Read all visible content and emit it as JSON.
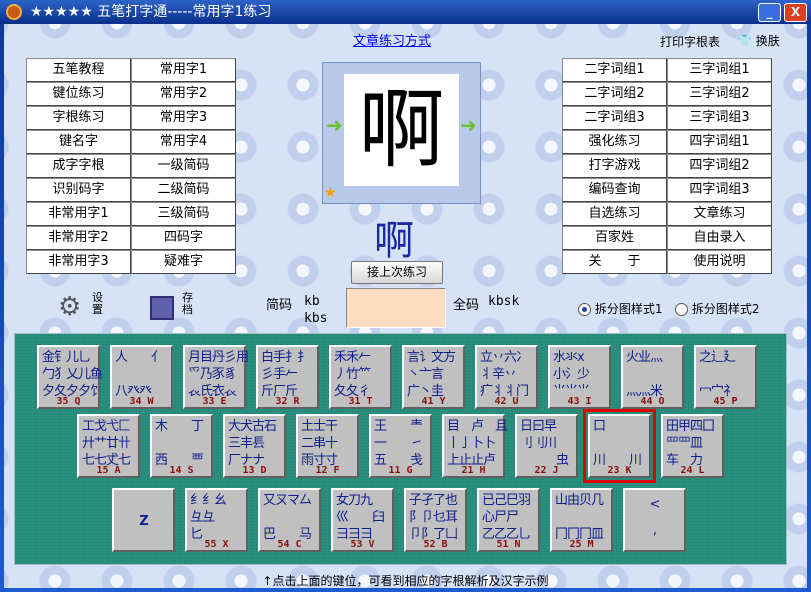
{
  "window": {
    "title": "★★★★★ 五笔打字通-----常用字1练习",
    "minimize": "_",
    "close": "X"
  },
  "top": {
    "link": "文章练习方式",
    "print": "打印字根表",
    "skin": "换肤"
  },
  "left_buttons": [
    "五笔教程",
    "常用字1",
    "键位练习",
    "常用字2",
    "字根练习",
    "常用字3",
    "键名字",
    "常用字4",
    "成字字根",
    "一级简码",
    "识别码字",
    "二级简码",
    "非常用字1",
    "三级简码",
    "非常用字2",
    "四码字",
    "非常用字3",
    "疑难字"
  ],
  "right_buttons": [
    "二字词组1",
    "三字词组1",
    "二字词组2",
    "三字词组2",
    "二字词组3",
    "三字词组3",
    "强化练习",
    "四字词组1",
    "打字游戏",
    "四字词组2",
    "编码查询",
    "四字词组3",
    "自选练习",
    "文章练习",
    "百家姓",
    "自由录入",
    "关　　于",
    "使用说明"
  ],
  "center": {
    "image_char": "啊",
    "current_char": "啊",
    "resume": "接上次练习"
  },
  "tools": {
    "settings": "设置",
    "save": "存档"
  },
  "code": {
    "short_label": "简码",
    "short_codes": [
      "kb",
      "kbs"
    ],
    "full_label": "全码",
    "full_code": "kbsk",
    "input_value": ""
  },
  "radios": [
    {
      "label": "拆分图样式1",
      "checked": true
    },
    {
      "label": "拆分图样式2",
      "checked": false
    }
  ],
  "keys_row1": [
    {
      "g": "金钅儿乚\n勹犭乂儿鱼\n夕夂夕夕饣",
      "c": "35 Q"
    },
    {
      "g": "人　　亻\n\n八癶癶",
      "c": "34 W"
    },
    {
      "g": "月目丹彡用\n爫乃豕豸\n𧘇氏衣𧘇",
      "c": "33 E"
    },
    {
      "g": "白手扌扌\n彡手𠂉\n斤厂斤",
      "c": "32 R"
    },
    {
      "g": "禾禾𠂉\n丿竹⺮\n夂夂彳",
      "c": "31 T"
    },
    {
      "g": "言讠文方\n丶亠言\n广丶圭",
      "c": "41 Y"
    },
    {
      "g": "立丷六冫\n丬辛丷\n疒丬丬门",
      "c": "42 U"
    },
    {
      "g": "水氺ⅹ\n小氵少\n⺌⺌⺌",
      "c": "43 I"
    },
    {
      "g": "火业灬\n\n灬灬米",
      "c": "44 O"
    },
    {
      "g": "之辶廴\n\n冖宀礻",
      "c": "45 P"
    }
  ],
  "keys_row2": [
    {
      "g": "工戈弋匚\n廾艹廿卄\n七七𠀋七",
      "c": "15 A"
    },
    {
      "g": "木　　丁\n\n西　　覀",
      "c": "14 S"
    },
    {
      "g": "大犬古石\n三丰镸\n厂ナナ",
      "c": "13 D"
    },
    {
      "g": "土士干\n二串十\n雨寸寸",
      "c": "12 F"
    },
    {
      "g": "王　　龶\n一　　㇀\n五　　戋",
      "c": "11 G"
    },
    {
      "g": "目　卢　且\n丨亅卜卜\n上止止卢",
      "c": "21 H"
    },
    {
      "g": "日曰早\n刂刂川\n　　　虫",
      "c": "22 J"
    },
    {
      "g": "口\n\n川　　川",
      "c": "23 K"
    },
    {
      "g": "田甲四囗\n罒罒皿\n车　力",
      "c": "24 L"
    }
  ],
  "keys_row3": [
    {
      "g": "Z",
      "c": "",
      "big": true
    },
    {
      "g": "纟纟幺\n彑彑\n匕　　",
      "c": "55 X"
    },
    {
      "g": "又ㄡマ厶\n\n巴　　马",
      "c": "54 C"
    },
    {
      "g": "女刀九\n巛　　臼\n彐彐彐",
      "c": "53 V"
    },
    {
      "g": "子孑了也\n阝卩乜耳\n卩阝了凵",
      "c": "52 B"
    },
    {
      "g": "已己巳羽\n心尸尸\n乙乙乙乚",
      "c": "51 N"
    },
    {
      "g": "山由贝几\n\n冂冂冂皿",
      "c": "25 M"
    },
    {
      "g": "<\n,",
      "c": "",
      "big": true
    }
  ],
  "selected_key": "23 K",
  "hint": "↑点击上面的键位，可看到相应的字根解析及汉字示例",
  "colors": {
    "panel": "#2a9080",
    "key_code": "#8a1010",
    "glyph": "#10208a",
    "highlight": "#e00000"
  }
}
